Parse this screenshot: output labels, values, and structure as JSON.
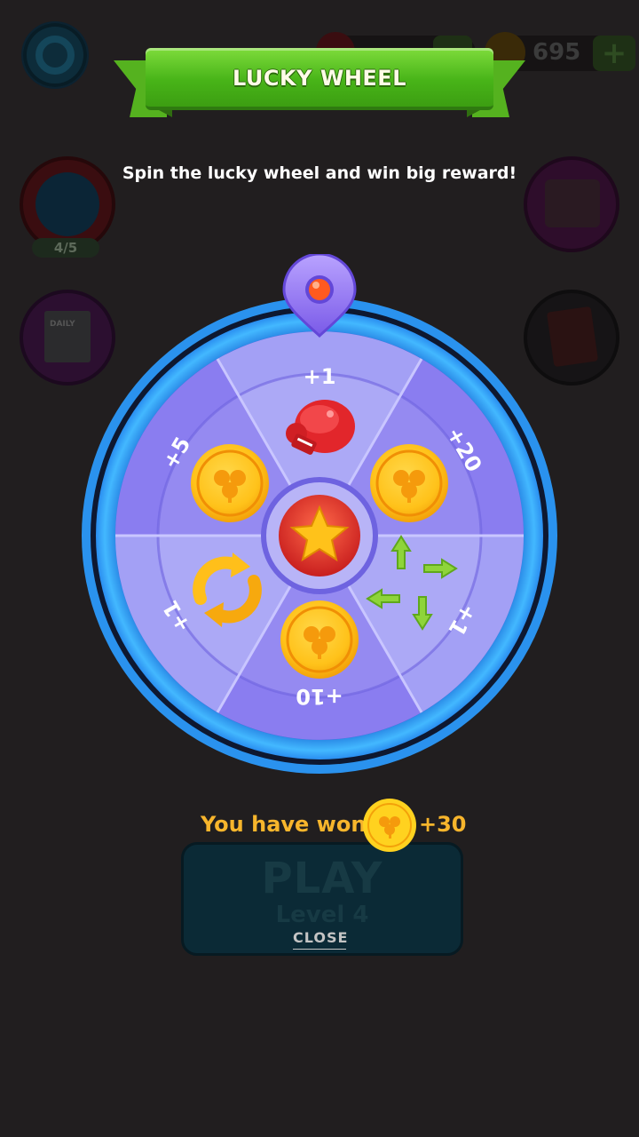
{
  "background_ui": {
    "wheel_progress": "4/5",
    "daily_label": "DAILY",
    "coin_count": "695",
    "coin_plus": "+",
    "play_label": "PLAY",
    "level_label": "Level 4"
  },
  "header": {
    "title": "LUCKY WHEEL",
    "subtitle": "Spin the lucky wheel and win big reward!"
  },
  "wheel": {
    "segments": [
      {
        "label": "+1",
        "reward": "boxing-glove-icon"
      },
      {
        "label": "+20",
        "reward": "clover-coin-icon"
      },
      {
        "label": "+1",
        "reward": "shuffle-arrows-icon"
      },
      {
        "label": "+10",
        "reward": "clover-coin-icon"
      },
      {
        "label": "+1",
        "reward": "undo-arrows-icon"
      },
      {
        "label": "+5",
        "reward": "clover-coin-icon"
      }
    ],
    "center_icon": "star-icon"
  },
  "result": {
    "won_text": "You have won",
    "amount": "+30",
    "reward_icon": "clover-coin-icon"
  },
  "close_label": "CLOSE",
  "colors": {
    "overlay": "#211e1f",
    "ribbon_green": "#48b418",
    "wheel_rim": "#2d9af0",
    "result_text": "#f7b52c"
  }
}
